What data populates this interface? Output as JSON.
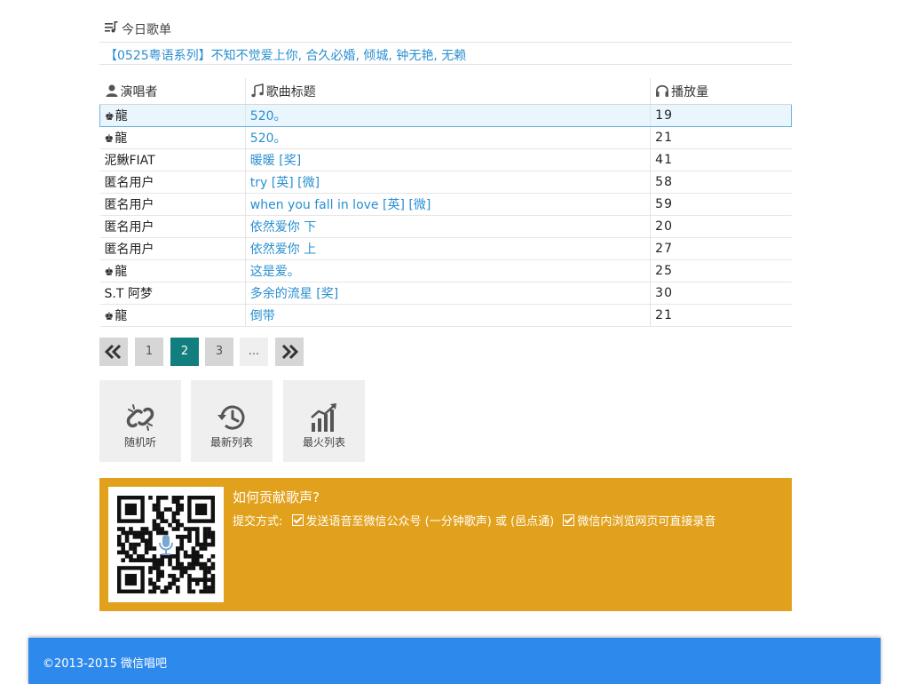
{
  "section": {
    "title": "今日歌单"
  },
  "playlist": {
    "title": "【0525粤语系列】不知不觉爱上你, 合久必婚, 倾城, 钟无艳, 无赖"
  },
  "table": {
    "headers": {
      "singer": "演唱者",
      "song": "歌曲标题",
      "plays": "播放量"
    },
    "rows": [
      {
        "singer": "龍",
        "crown": true,
        "title": "520。",
        "plays": "19",
        "highlighted": true
      },
      {
        "singer": "龍",
        "crown": true,
        "title": "520。",
        "plays": "21"
      },
      {
        "singer": "泥鳅FIAT",
        "crown": false,
        "title": "暖暖 [奖]",
        "plays": "41"
      },
      {
        "singer": "匿名用户",
        "crown": false,
        "title": "try [英] [微]",
        "plays": "58"
      },
      {
        "singer": "匿名用户",
        "crown": false,
        "title": "when you fall in love [英] [微]",
        "plays": "59"
      },
      {
        "singer": "匿名用户",
        "crown": false,
        "title": "依然爱你 下",
        "plays": "20"
      },
      {
        "singer": "匿名用户",
        "crown": false,
        "title": "依然爱你 上",
        "plays": "27"
      },
      {
        "singer": "龍",
        "crown": true,
        "title": "这是爱。",
        "plays": "25"
      },
      {
        "singer": "S.T 阿梦",
        "crown": false,
        "title": "多余的流星 [奖]",
        "plays": "30"
      },
      {
        "singer": "龍",
        "crown": true,
        "title": "倒带",
        "plays": "21"
      }
    ]
  },
  "pagination": {
    "prev": "«",
    "pages": [
      "1",
      "2",
      "3"
    ],
    "current": "2",
    "ellipsis": "...",
    "next": "»"
  },
  "tiles": {
    "random": "随机听",
    "latest": "最新列表",
    "hottest": "最火列表"
  },
  "contribute": {
    "title": "如何贡献歌声?",
    "method_label": "提交方式:",
    "option1": "发送语音至微信公众号 (一分钟歌声) 或 (邑点通)",
    "option2": "微信内浏览网页可直接录音"
  },
  "footer": {
    "copyright": "©2013-2015 微信唱吧"
  },
  "colors": {
    "accent_link": "#2a8fd0",
    "active_page": "#127e7e",
    "contribute_bg": "#e2a11c",
    "footer_bg": "#2e89ec"
  },
  "icons": [
    "playlist-icon",
    "user-icon",
    "music-note-icon",
    "headphones-icon",
    "double-chevron-left-icon",
    "double-chevron-right-icon",
    "broken-link-icon",
    "history-icon",
    "bar-chart-icon",
    "qr-code",
    "checkbox-icon"
  ]
}
